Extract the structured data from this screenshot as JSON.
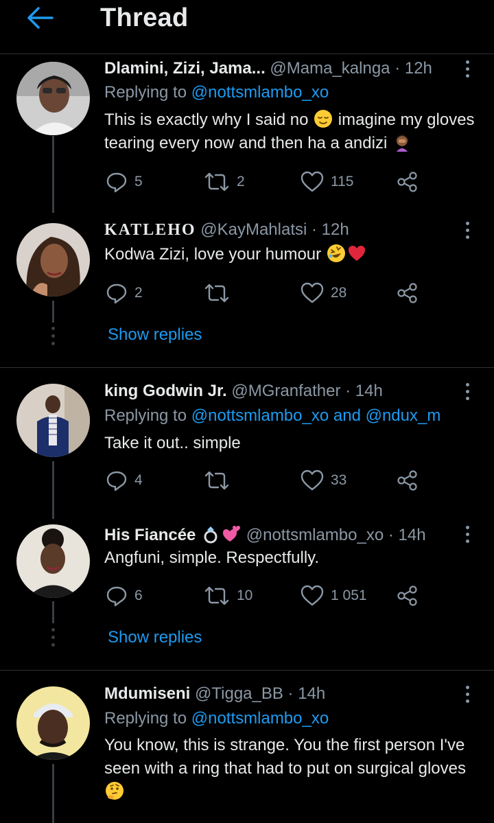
{
  "header": {
    "title": "Thread"
  },
  "tweets": [
    {
      "name": "Dlamini, Zizi, Jama...",
      "meta": " @Mama_kalnga · 12h",
      "reply_prefix": "Replying to ",
      "reply_to": "@nottsmlambo_xo",
      "text": "This is exactly why I said no",
      "text2": " imagine my gloves tearing every now and then ha a andizi ",
      "replies": "5",
      "retweets": "2",
      "likes": "115"
    },
    {
      "name": "KATLEHO",
      "meta": " @KayMahlatsi · 12h",
      "text": "Kodwa Zizi, love your humour ",
      "replies": "2",
      "retweets": "",
      "likes": "28"
    },
    {
      "name": "king Godwin Jr.",
      "meta": " @MGranfather · 14h",
      "reply_prefix": "Replying to ",
      "reply_to": "@nottsmlambo_xo and @ndux_m",
      "text": "Take it out.. simple",
      "replies": "4",
      "retweets": "",
      "likes": "33"
    },
    {
      "name": "His Fiancée ",
      "meta": " @nottsmlambo_xo · 14h",
      "text": "Angfuni, simple. Respectfully.",
      "replies": "6",
      "retweets": "10",
      "likes": "1 051"
    },
    {
      "name": "Mdumiseni",
      "meta": " @Tigga_BB · 14h",
      "reply_prefix": "Replying to ",
      "reply_to": "@nottsmlambo_xo",
      "text": "You know, this is strange. You the first person I've seen with a ring that had to put on surgical gloves"
    }
  ],
  "show_replies_label": "Show replies",
  "icons": {
    "back": "arrow-left-icon",
    "reply": "reply-icon",
    "retweet": "retweet-icon",
    "like": "heart-icon",
    "share": "share-icon",
    "more": "more-vertical-icon"
  },
  "colors": {
    "background": "#000000",
    "accent": "#1d9bf0",
    "secondary_text": "#8b98a5",
    "divider": "#2f3336"
  }
}
